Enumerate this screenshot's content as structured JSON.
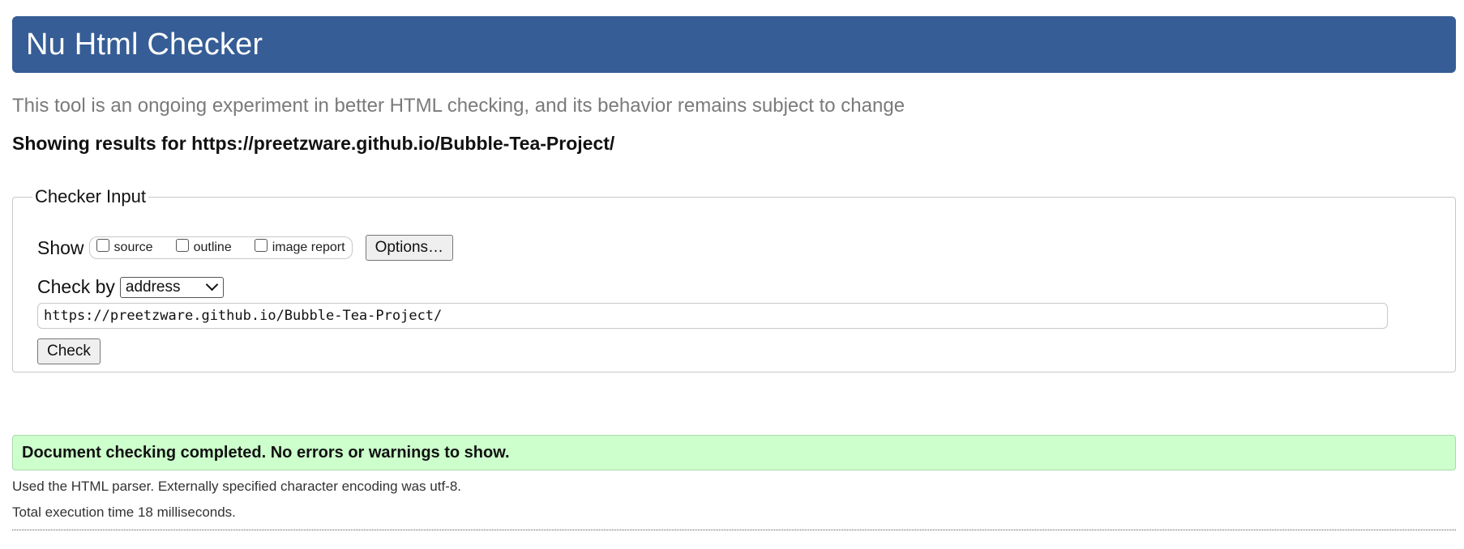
{
  "header": {
    "title": "Nu Html Checker",
    "background_color": "#365d95"
  },
  "subtitle": "This tool is an ongoing experiment in better HTML checking, and its behavior remains subject to change",
  "results_for": "Showing results for https://preetzware.github.io/Bubble-Tea-Project/",
  "checker_input": {
    "legend": "Checker Input",
    "show_label": "Show",
    "show_options": [
      {
        "label": "source",
        "checked": false
      },
      {
        "label": "outline",
        "checked": false
      },
      {
        "label": "image report",
        "checked": false
      }
    ],
    "options_button": "Options…",
    "check_by_label": "Check by",
    "check_by_selected": "address",
    "url_value": "https://preetzware.github.io/Bubble-Tea-Project/",
    "check_button": "Check"
  },
  "status": {
    "message": "Document checking completed. No errors or warnings to show.",
    "background_color": "#ccffcc"
  },
  "details": [
    "Used the HTML parser. Externally specified character encoding was utf-8.",
    "Total execution time 18 milliseconds."
  ]
}
